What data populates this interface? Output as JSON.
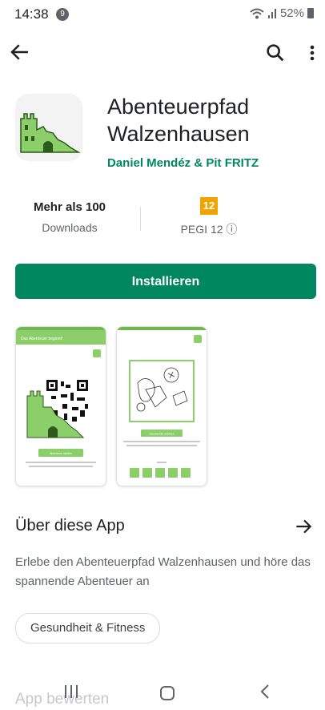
{
  "status_bar": {
    "time": "14:38",
    "notification_count": "9",
    "battery": "52%"
  },
  "app_bar": {
    "back_icon": "arrow-left-icon",
    "search_icon": "search-icon",
    "more_icon": "more-vert-icon"
  },
  "app": {
    "title": "Abenteuerpfad Walzenhausen",
    "developer": "Daniel Mendéz & Pit FRITZ",
    "icon": "castle-ruin-icon"
  },
  "stats": {
    "downloads_value": "Mehr als 100",
    "downloads_label": "Downloads",
    "rating_badge": "12",
    "rating_label": "PEGI 12 ⓘ"
  },
  "install_label": "Installieren",
  "screenshots": [
    {
      "header_text": "Das Abenteuer beginnt!",
      "button_text": "Abenteuer starten"
    },
    {
      "button_text": "Geschichte anhören"
    }
  ],
  "about": {
    "title": "Über diese App",
    "description": "Erlebe den Abenteuerpfad Walzenhausen und höre das spannende Abenteuer an",
    "category": "Gesundheit & Fitness"
  },
  "rate_title": "App bewerten",
  "colors": {
    "accent": "#01875f",
    "pegi": "#f1a400",
    "icon_green": "#8ccf6a"
  }
}
